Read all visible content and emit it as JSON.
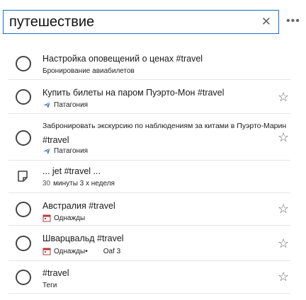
{
  "search": {
    "value": "путешествие",
    "clear_icon": "close-icon"
  },
  "toolbar": {
    "more_icon": "more-icon"
  },
  "tasks": [
    {
      "title": "Настройка оповещений о ценах #travel",
      "subtitle": "Бронирование авиабилетов"
    },
    {
      "title": "Купить билеты на паром Пуэрто-Мон #travel",
      "list": "Патагония",
      "list_icon": "airplane-icon"
    },
    {
      "title": "Забронировать экскурсию по наблюдениям за китами в Пуэрто-Марин",
      "title_line2": "#travel",
      "list": "Патагония",
      "list_icon": "airplane-icon"
    },
    {
      "title": "... jet #travel ...",
      "num": "30",
      "subtitle": "минуты 3 х неделя",
      "type_icon": "note-icon"
    },
    {
      "title": "Австралия #travel",
      "list": "Однажды",
      "list_icon": "calendar-icon"
    },
    {
      "title": "Шварцвальд #travel",
      "list": "Однажды•",
      "extra": "Oaf 3",
      "list_icon": "calendar-icon"
    },
    {
      "title": "#travel",
      "subtitle": "Теги"
    }
  ]
}
